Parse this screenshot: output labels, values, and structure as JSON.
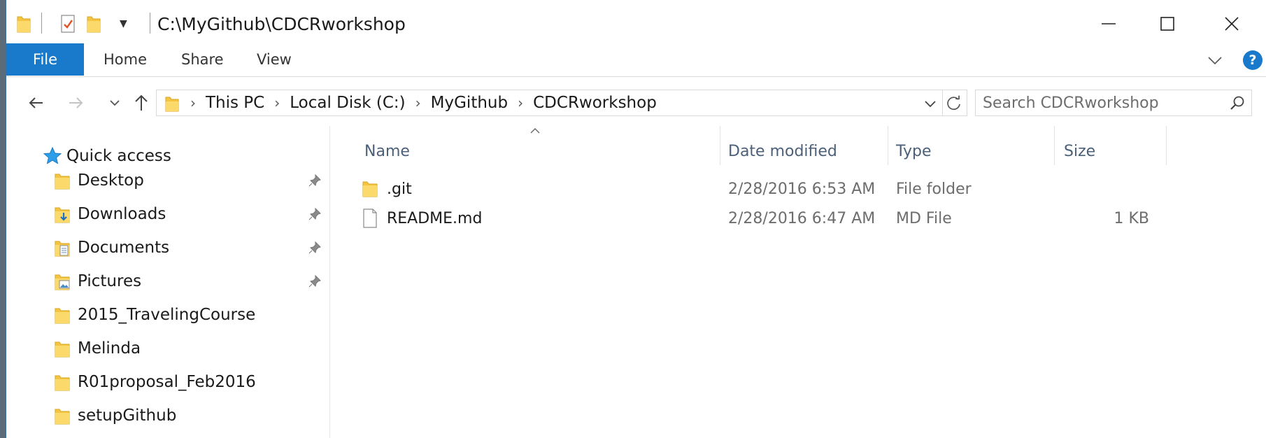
{
  "titlebar": {
    "path": "C:\\MyGithub\\CDCRworkshop"
  },
  "ribbon": {
    "tabs": [
      {
        "label": "File"
      },
      {
        "label": "Home"
      },
      {
        "label": "Share"
      },
      {
        "label": "View"
      }
    ],
    "help_label": "?"
  },
  "navbar": {
    "breadcrumbs": [
      "This PC",
      "Local Disk (C:)",
      "MyGithub",
      "CDCRworkshop"
    ],
    "search_placeholder": "Search CDCRworkshop"
  },
  "sidebar": {
    "quick_access_label": "Quick access",
    "items": [
      {
        "label": "Desktop",
        "icon": "desktop-folder-icon",
        "pinned": true
      },
      {
        "label": "Downloads",
        "icon": "downloads-folder-icon",
        "pinned": true
      },
      {
        "label": "Documents",
        "icon": "documents-folder-icon",
        "pinned": true
      },
      {
        "label": "Pictures",
        "icon": "pictures-folder-icon",
        "pinned": true
      },
      {
        "label": "2015_TravelingCourse",
        "icon": "folder-icon",
        "pinned": false
      },
      {
        "label": "Melinda",
        "icon": "folder-icon",
        "pinned": false
      },
      {
        "label": "R01proposal_Feb2016",
        "icon": "folder-icon",
        "pinned": false
      },
      {
        "label": "setupGithub",
        "icon": "folder-icon",
        "pinned": false
      }
    ]
  },
  "filelist": {
    "columns": [
      "Name",
      "Date modified",
      "Type",
      "Size"
    ],
    "rows": [
      {
        "name": ".git",
        "date": "2/28/2016 6:53 AM",
        "type": "File folder",
        "size": "",
        "icon": "folder-icon"
      },
      {
        "name": "README.md",
        "date": "2/28/2016 6:47 AM",
        "type": "MD File",
        "size": "1 KB",
        "icon": "file-icon"
      }
    ]
  },
  "colors": {
    "accent": "#1979ca",
    "folder": "#f5c542",
    "header_text": "#4c607a"
  }
}
